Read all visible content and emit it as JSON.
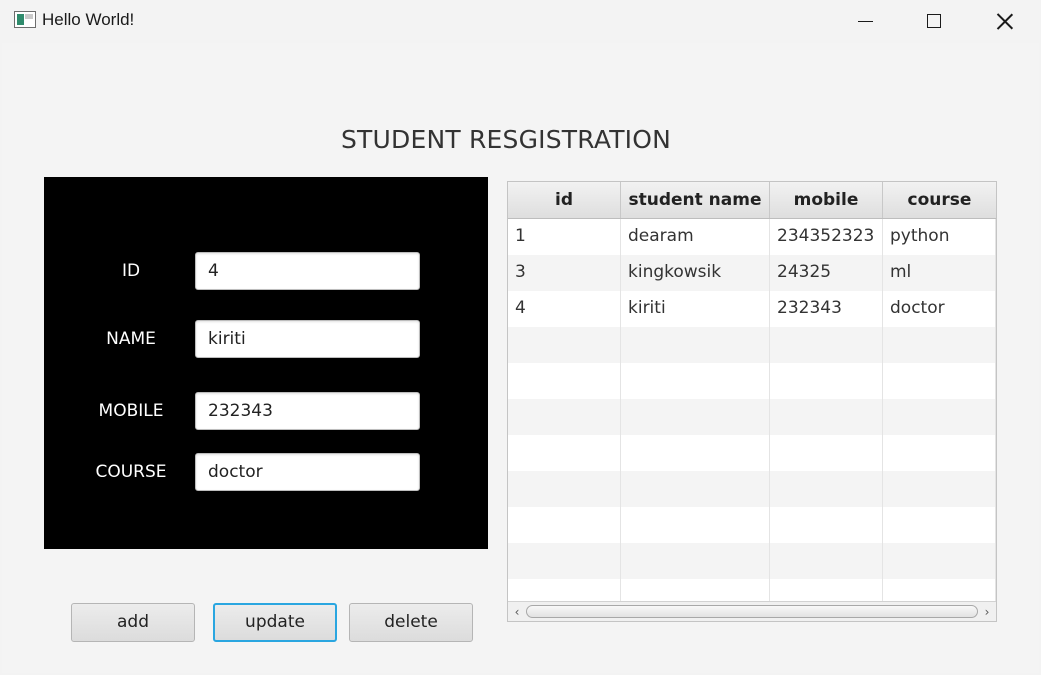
{
  "window": {
    "title": "Hello World!",
    "minimize_icon": "minimize-icon",
    "maximize_icon": "maximize-icon",
    "close_icon": "close-icon"
  },
  "heading": "STUDENT RESGISTRATION",
  "form": {
    "id_label": "ID",
    "id_value": "4",
    "name_label": "NAME",
    "name_value": "kiriti",
    "mobile_label": "MOBILE",
    "mobile_value": "232343",
    "course_label": "COURSE",
    "course_value": "doctor"
  },
  "buttons": {
    "add": "add",
    "update": "update",
    "delete": "delete"
  },
  "table": {
    "columns": [
      "id",
      "student name",
      "mobile",
      "course"
    ],
    "rows": [
      [
        "1",
        "dearam",
        "234352323",
        "python"
      ],
      [
        "3",
        "kingkowsik",
        "24325",
        "ml"
      ],
      [
        "4",
        "kiriti",
        "232343",
        "doctor"
      ]
    ]
  },
  "colors": {
    "focus_border": "#2aa6e0",
    "form_background": "#000000"
  }
}
